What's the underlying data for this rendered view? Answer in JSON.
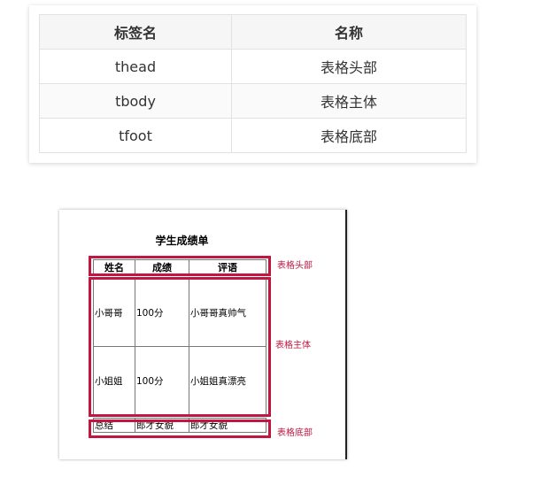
{
  "ref_table": {
    "headers": [
      "标签名",
      "名称"
    ],
    "rows": [
      [
        "thead",
        "表格头部"
      ],
      [
        "tbody",
        "表格主体"
      ],
      [
        "tfoot",
        "表格底部"
      ]
    ]
  },
  "demo": {
    "caption": "学生成绩单",
    "headers": [
      "姓名",
      "成绩",
      "评语"
    ],
    "body_rows": [
      [
        "小哥哥",
        "100分",
        "小哥哥真帅气"
      ],
      [
        "小姐姐",
        "100分",
        "小姐姐真漂亮"
      ]
    ],
    "foot_row": [
      "总结",
      "郎才女貌",
      "郎才女貌"
    ],
    "annotations": {
      "head": "表格头部",
      "body": "表格主体",
      "foot": "表格底部"
    },
    "highlight_color": "#c0163f"
  }
}
